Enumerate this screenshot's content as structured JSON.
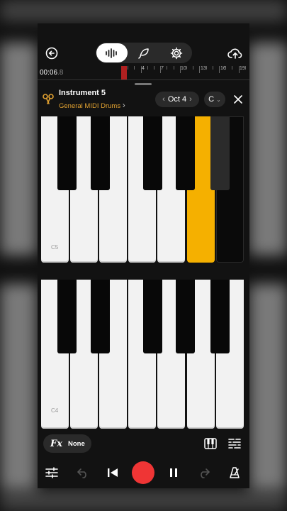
{
  "topbar": {
    "back_icon": "back-icon",
    "modes": [
      "waveform-icon",
      "feather-icon",
      "gear-icon"
    ],
    "upload_icon": "cloud-upload-icon"
  },
  "timeline": {
    "time_main": "00:06",
    "time_frac": ".8",
    "ruler_numbers": [
      "4",
      "7",
      "10",
      "13",
      "16",
      "19"
    ]
  },
  "instrument": {
    "name": "Instrument 5",
    "preset": "General MIDI Drums",
    "octave_label": "Oct 4",
    "key_label": "C"
  },
  "keyboard": {
    "upper_label": "C5",
    "lower_label": "C4",
    "active_white_key_index": 5,
    "accent_color": "#f5b000"
  },
  "fx": {
    "icon_text": "Fx",
    "value": "None"
  },
  "transport": {
    "record_color": "#ef3535"
  }
}
